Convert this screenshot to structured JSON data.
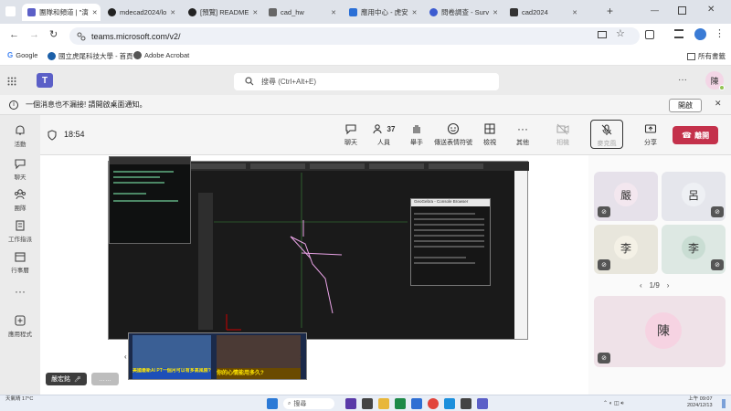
{
  "browser": {
    "tabs": [
      {
        "label": "團隊和頻道 | \"演",
        "color": "#5b5fc7"
      },
      {
        "label": "mdecad2024/lo",
        "color": "#222"
      },
      {
        "label": "[預覽] README",
        "color": "#222"
      },
      {
        "label": "cad_hw",
        "color": "#555"
      },
      {
        "label": "應用中心 - 虎安",
        "color": "#2a6fd6"
      },
      {
        "label": "問卷調查 - Surv",
        "color": "#3c5bd0"
      },
      {
        "label": "cad2024",
        "color": "#333"
      }
    ],
    "url": "teams.microsoft.com/v2/",
    "bookmarks": [
      "Google",
      "國立虎尾科技大學 - 首頁",
      "Adobe Acrobat"
    ],
    "all_bookmarks": "所有書籤"
  },
  "teams": {
    "search_placeholder": "搜尋 (Ctrl+Alt+E)",
    "avatar_initial": "陳",
    "notification": "一個消息也不漏接! 請開啟桌面通知。",
    "notification_button": "開啟"
  },
  "sidebar": {
    "items": [
      {
        "label": "活動",
        "icon": "bell-icon"
      },
      {
        "label": "聊天",
        "icon": "chat-icon"
      },
      {
        "label": "團隊",
        "icon": "teams-icon"
      },
      {
        "label": "工作指派",
        "icon": "assignment-icon"
      },
      {
        "label": "行事曆",
        "icon": "calendar-icon"
      },
      {
        "label": "",
        "icon": "more-icon"
      },
      {
        "label": "應用程式",
        "icon": "apps-icon"
      }
    ]
  },
  "meeting": {
    "timer": "18:54",
    "controls": [
      {
        "label": "聊天",
        "icon": "chat-icon"
      },
      {
        "label": "人員",
        "icon": "people-icon",
        "count": "37"
      },
      {
        "label": "舉手",
        "icon": "raise-hand-icon"
      },
      {
        "label": "傳送表情符號",
        "icon": "emoji-icon"
      },
      {
        "label": "檢視",
        "icon": "view-icon"
      },
      {
        "label": "其他",
        "icon": "more-icon"
      },
      {
        "label": "相機",
        "icon": "camera-off-icon"
      },
      {
        "label": "麥克風",
        "icon": "mic-off-icon"
      },
      {
        "label": "分享",
        "icon": "share-icon"
      }
    ],
    "leave_label": "離開"
  },
  "participants": {
    "tiles": [
      "嚴",
      "呂",
      "李",
      "李",
      "陳"
    ],
    "page": "1/9",
    "stage_names": [
      "嚴宏銘",
      "……"
    ]
  },
  "shared_screen": {
    "window_title": "GeoGebra - Console Browser",
    "news_caption_1": "美國最新AI PT一個月可以有多高風險?",
    "news_caption_2": "你的心情能用多久?"
  },
  "taskbar": {
    "weather": "天氣晴 17°C",
    "search": "搜尋",
    "time": "上午 09:07",
    "date": "2024/12/13"
  },
  "colors": {
    "teams_purple": "#5b5fc7",
    "leave_red": "#c4314b"
  }
}
